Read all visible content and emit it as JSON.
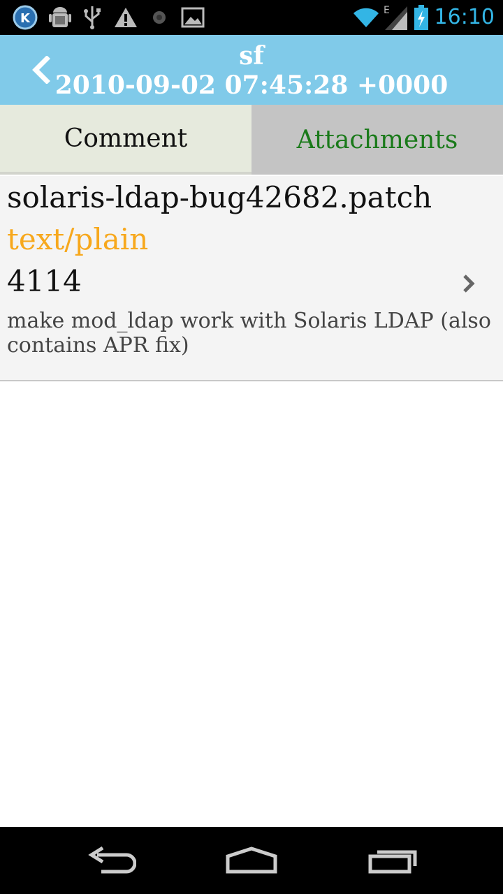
{
  "status_bar": {
    "time": "16:10",
    "network_label": "E",
    "icons": [
      "k-app-icon",
      "android-debug-icon",
      "usb-icon",
      "warning-icon",
      "record-icon",
      "image-icon",
      "wifi-icon",
      "signal-icon",
      "battery-charging-icon"
    ],
    "time_color": "#33b5e5"
  },
  "header": {
    "title": "sf",
    "subtitle": "2010-09-02 07:45:28 +0000",
    "background_color": "#80cae9"
  },
  "tabs": [
    {
      "label": "Comment",
      "selected": false
    },
    {
      "label": "Attachments",
      "selected": true
    }
  ],
  "attachments": [
    {
      "filename": "solaris-ldap-bug42682.patch",
      "mime_type": "text/plain",
      "size": "4114",
      "description": "make mod_ldap work with Solaris LDAP (also contains APR fix)"
    }
  ],
  "colors": {
    "mime_type": "#f7a81d",
    "attachments_tab_text": "#1a7a1a"
  },
  "nav_bar": {
    "icons": [
      "back-icon",
      "home-icon",
      "recent-apps-icon"
    ]
  }
}
